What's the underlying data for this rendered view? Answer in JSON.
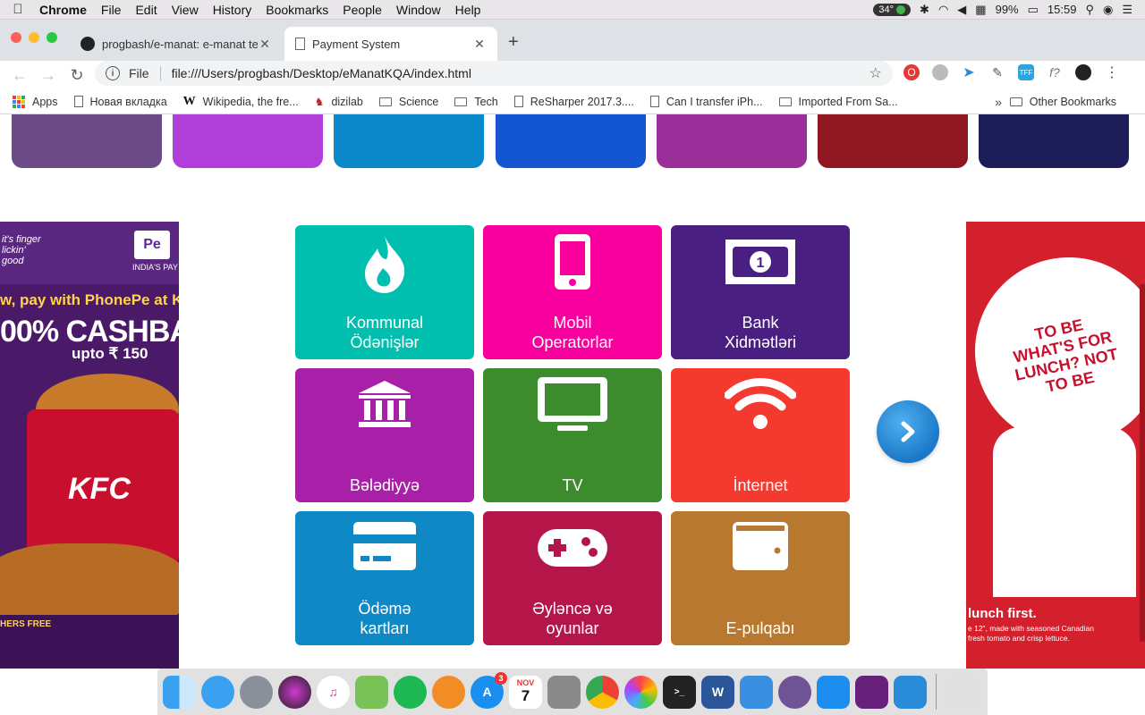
{
  "menubar": {
    "app": "Chrome",
    "items": [
      "File",
      "Edit",
      "View",
      "History",
      "Bookmarks",
      "People",
      "Window",
      "Help"
    ],
    "temp": "34°",
    "battery": "99%",
    "clock": "15:59"
  },
  "tabs": [
    {
      "title": "progbash/e-manat: e-manat te"
    },
    {
      "title": "Payment System"
    }
  ],
  "toolbar": {
    "scheme_label": "File",
    "url": "file:///Users/progbash/Desktop/eManatKQA/index.html"
  },
  "bookmarks": {
    "items": [
      "Apps",
      "Новая вкладка",
      "Wikipedia, the fre...",
      "dizilab",
      "Science",
      "Tech",
      "ReSharper 2017.3....",
      "Can I transfer iPh...",
      "Imported From Sa..."
    ],
    "overflow": "»",
    "other": "Other Bookmarks"
  },
  "colors": {
    "top_cards": [
      "#6b4a86",
      "#b03fd9",
      "#0a88c9",
      "#1456d2",
      "#9a2f9a",
      "#8f1820",
      "#1d1d5a"
    ]
  },
  "ads": {
    "left": {
      "brand_mark": "Pe",
      "brand_sub": "INDIA'S PAY",
      "tagline": "it's finger lickin' good",
      "headline": "w, pay with PhonePe at K",
      "cashback": "00% CASHBAC",
      "upto": "upto ₹ 150",
      "brand": "KFC",
      "footer": "HERS FREE"
    },
    "right": {
      "bubble": "TO BE WHAT'S FOR LUNCH? NOT TO BE",
      "headline": "lunch first.",
      "sub": "e 12\", made with seasoned Canadian fresh tomato and crisp lettuce."
    }
  },
  "tiles": [
    {
      "name": "kommunal",
      "line1": "Kommunal",
      "line2": "Ödənişlər",
      "color": "#00bfae",
      "icon": "flame-icon"
    },
    {
      "name": "mobil",
      "line1": "Mobil",
      "line2": "Operatorlar",
      "color": "#f7009e",
      "icon": "phone-icon"
    },
    {
      "name": "bank",
      "line1": "Bank",
      "line2": "Xidmətləri",
      "color": "#4a1f82",
      "icon": "banknote-icon"
    },
    {
      "name": "beledyye",
      "line1": "",
      "line2": "Bələdiyyə",
      "color": "#a820a8",
      "icon": "institution-icon"
    },
    {
      "name": "tv",
      "line1": "",
      "line2": "TV",
      "color": "#3c8c2d",
      "icon": "tv-icon"
    },
    {
      "name": "internet",
      "line1": "",
      "line2": "İnternet",
      "color": "#f43a2e",
      "icon": "wifi-icon"
    },
    {
      "name": "cards",
      "line1": "Ödəmə",
      "line2": "kartları",
      "color": "#0f89c6",
      "icon": "credit-card-icon"
    },
    {
      "name": "games",
      "line1": "Əyləncə və",
      "line2": "oyunlar",
      "color": "#b5164a",
      "icon": "gamepad-icon"
    },
    {
      "name": "wallet",
      "line1": "",
      "line2": "E-pulqabı",
      "color": "#b8782f",
      "icon": "wallet-icon"
    }
  ],
  "dock": {
    "appstore_badge": "3",
    "calendar_month": "NOV",
    "calendar_day": "7"
  }
}
